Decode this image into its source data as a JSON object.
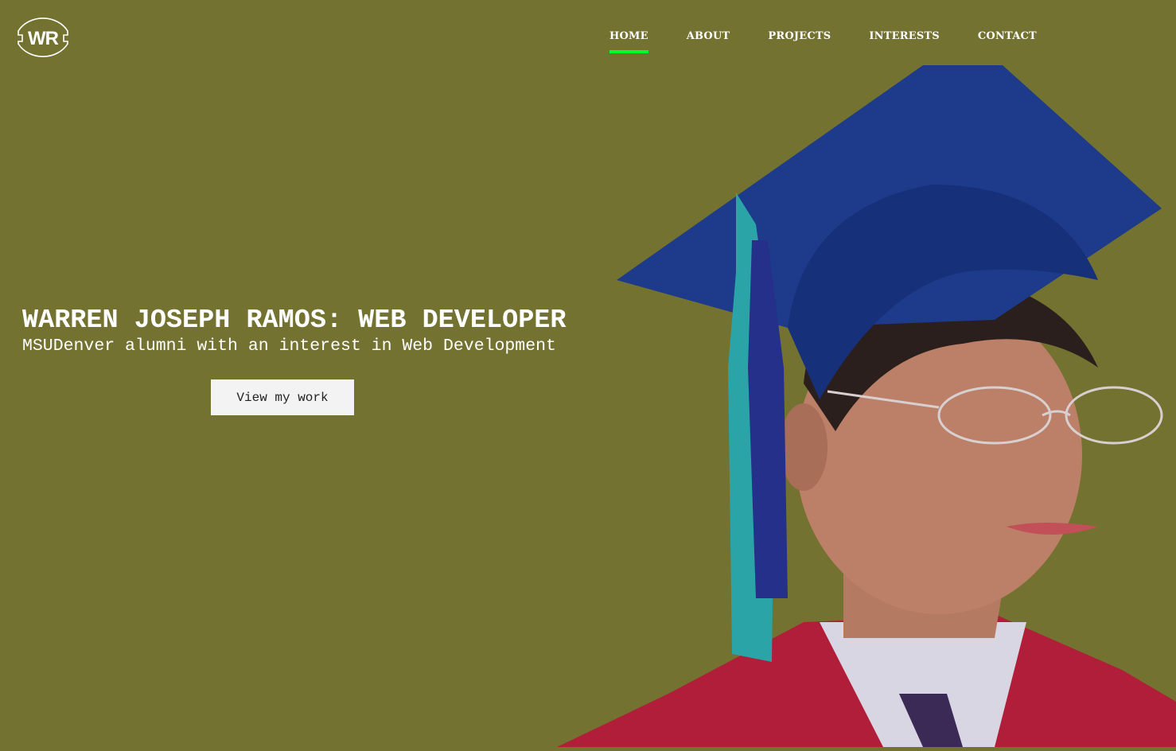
{
  "logo": {
    "text": "WR"
  },
  "nav": {
    "items": [
      {
        "label": "HOME",
        "active": true
      },
      {
        "label": "ABOUT"
      },
      {
        "label": "PROJECTS"
      },
      {
        "label": "INTERESTS"
      },
      {
        "label": "CONTACT"
      }
    ],
    "active_color": "#00ff2a"
  },
  "hero": {
    "title": "WARREN JOSEPH RAMOS: WEB DEVELOPER",
    "subtitle": "MSUDenver alumni with an interest in Web Development",
    "button_label": "View my work"
  },
  "colors": {
    "background": "#737230"
  }
}
